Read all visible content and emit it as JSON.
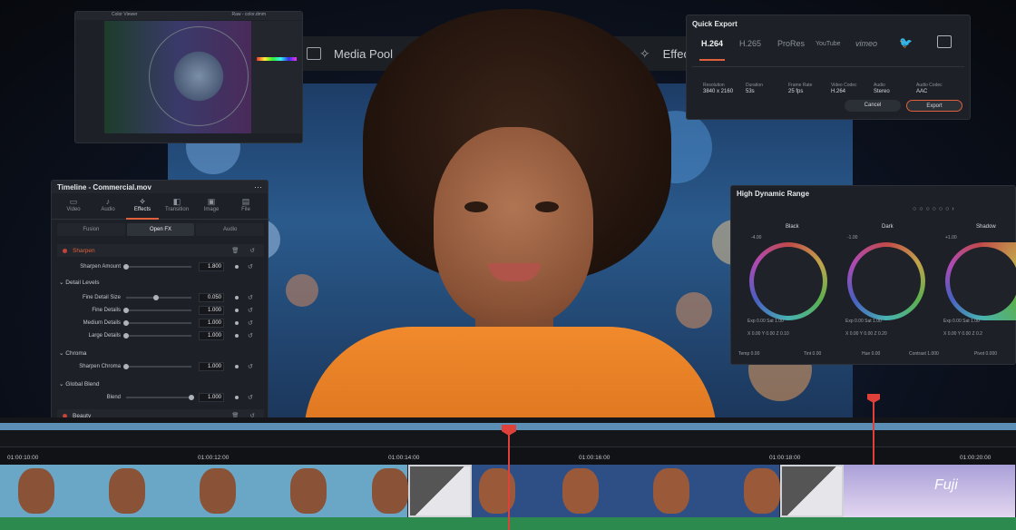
{
  "topbar": {
    "media_pool": "Media Pool",
    "effects": "Effec"
  },
  "scope": {
    "title": "Color Viewer",
    "subtitle": "Raw - color.dmm"
  },
  "quick_export": {
    "title": "Quick Export",
    "formats": [
      "H.264",
      "H.265",
      "ProRes",
      "YouTube",
      "vimeo"
    ],
    "specs": [
      {
        "label": "Resolution",
        "value": "3840 x 2160"
      },
      {
        "label": "Duration",
        "value": "53s"
      },
      {
        "label": "Frame Rate",
        "value": "25 fps"
      },
      {
        "label": "Video Codec",
        "value": "H.264"
      },
      {
        "label": "Audio",
        "value": "Stereo"
      },
      {
        "label": "Audio Codec",
        "value": "AAC"
      }
    ],
    "cancel": "Cancel",
    "export": "Export"
  },
  "inspector": {
    "title": "Timeline - Commercial.mov",
    "tabs": [
      "Video",
      "Audio",
      "Effects",
      "Transition",
      "Image",
      "File"
    ],
    "subtabs": [
      "Fusion",
      "Open FX",
      "Audio"
    ],
    "sharpen": "Sharpen",
    "sharpen_amount": {
      "label": "Sharpen Amount",
      "value": "1.800"
    },
    "detail_levels": "Detail Levels",
    "fine_detail_size": {
      "label": "Fine Detail Size",
      "value": "0.050"
    },
    "fine_details": {
      "label": "Fine Details",
      "value": "1.000"
    },
    "medium_details": {
      "label": "Medium Details",
      "value": "1.000"
    },
    "large_details": {
      "label": "Large Details",
      "value": "1.000"
    },
    "chroma": "Chroma",
    "sharpen_chroma": {
      "label": "Sharpen Chroma",
      "value": "1.000"
    },
    "global_blend": "Global Blend",
    "blend": {
      "label": "Blend",
      "value": "1.000"
    },
    "beauty": "Beauty"
  },
  "hdr": {
    "title": "High Dynamic Range",
    "wheels": [
      {
        "name": "Black",
        "top": "-4.00",
        "exp": "0.00",
        "sat": "1.00",
        "x": "0.00",
        "y": "0.00",
        "z": "0.10"
      },
      {
        "name": "Dark",
        "top": "-1.00",
        "exp": "0.00",
        "sat": "1.00",
        "x": "0.00",
        "y": "0.00",
        "z": "0.20"
      },
      {
        "name": "Shadow",
        "top": "+1.00",
        "exp": "0.00",
        "sat": "1.00",
        "x": "0.00",
        "y": "0.00",
        "z": "0.2"
      }
    ],
    "footer": [
      {
        "label": "Temp",
        "value": "0.00"
      },
      {
        "label": "Tint",
        "value": "0.00"
      },
      {
        "label": "Hue",
        "value": "0.00"
      },
      {
        "label": "Contrast",
        "value": "1.000"
      },
      {
        "label": "Pivot",
        "value": "0.000"
      }
    ]
  },
  "timeline": {
    "timecodes": [
      "01:00:10:00",
      "01:00:12:00",
      "01:00:14:00",
      "01:00:16:00",
      "01:00:18:00",
      "01:00:20:00"
    ],
    "fuji_text": "Fuji"
  },
  "colors": {
    "accent": "#e0603c",
    "playhead": "#e0403a",
    "panel": "#1d2026",
    "sweater": "#f08a2c"
  }
}
